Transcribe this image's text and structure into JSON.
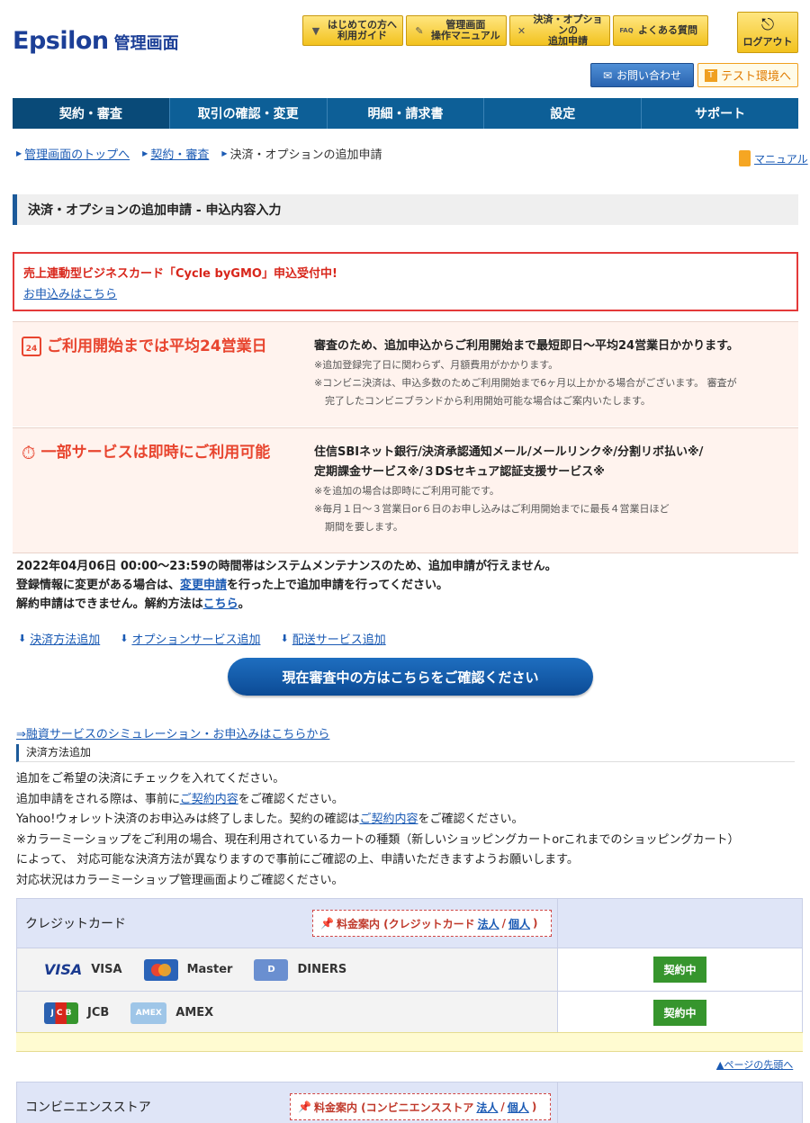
{
  "header": {
    "logo": "Epsilon",
    "logo_sub": "管理画面",
    "help_buttons": [
      {
        "icon": "beginner-icon",
        "label": "はじめての方へ\n利用ガイド"
      },
      {
        "icon": "pencil-icon",
        "label": "管理画面\n操作マニュアル"
      },
      {
        "icon": "tools-icon",
        "label": "決済・オプションの\n追加申請"
      },
      {
        "icon": "faq-icon",
        "label": "よくある質問"
      }
    ],
    "logout": "ログアウト",
    "contact": "お問い合わせ",
    "test_env": "テスト環境へ"
  },
  "nav": [
    {
      "label": "契約・審査",
      "active": true
    },
    {
      "label": "取引の確認・変更"
    },
    {
      "label": "明細・請求書"
    },
    {
      "label": "設定"
    },
    {
      "label": "サポート"
    }
  ],
  "breadcrumb": [
    "管理画面のトップへ",
    "契約・審査",
    "決済・オプションの追加申請"
  ],
  "manual": "マニュアル",
  "page_title": "決済・オプションの追加申請 - 申込内容入力",
  "notice": {
    "title": "売上連動型ビジネスカード「Cycle byGMO」申込受付中!",
    "link": "お申込みはこちら"
  },
  "info1": {
    "icon_text": "24",
    "heading": "ご利用開始までは平均24営業日",
    "title": "審査のため、追加申込からご利用開始まで最短即日～平均24営業日かかります。",
    "note1": "※追加登録完了日に関わらず、月額費用がかかります。",
    "note2": "※コンビニ決済は、申込多数のためご利用開始まで6ヶ月以上かかる場合がございます。 審査が",
    "note3": "完了したコンビニブランドから利用開始可能な場合はご案内いたします。"
  },
  "info2": {
    "heading": "一部サービスは即時にご利用可能",
    "title1": "住信SBIネット銀行/決済承認通知メール/メールリンク※/分割リボ払い※/",
    "title2": "定期課金サービス※/３DSセキュア認証支援サービス※",
    "note1": "※を追加の場合は即時にご利用可能です。",
    "note2": "※毎月１日～３営業日or６日のお申し込みはご利用開始までに最長４営業日ほど",
    "note3": "期間を要します。"
  },
  "maintenance": {
    "line1": "2022年04月06日 00:00～23:59の時間帯はシステムメンテナンスのため、追加申請が行えません。",
    "line2_pre": "登録情報に変更がある場合は、",
    "line2_link": "変更申請",
    "line2_post": "を行った上で追加申請を行ってください。",
    "line3_pre": "解約申請はできません。解約方法は",
    "line3_link": "こちら",
    "line3_post": "。"
  },
  "anchors": [
    "決済方法追加",
    "オプションサービス追加",
    "配送サービス追加"
  ],
  "review_button": "現在審査中の方はこちらをご確認ください",
  "finance_link": "⇒融資サービスのシミュレーション・お申込みはこちらから",
  "section_title": "決済方法追加",
  "description": {
    "l1": "追加をご希望の決済にチェックを入れてください。",
    "l2_pre": "追加申請をされる際は、事前に",
    "l2_link": "ご契約内容",
    "l2_post": "をご確認ください。",
    "l3_pre": "Yahoo!ウォレット決済のお申込みは終了しました。契約の確認は",
    "l3_link": "ご契約内容",
    "l3_post": "をご確認ください。",
    "l4": "※カラーミーショップをご利用の場合、現在利用されているカートの種類（新しいショッピングカートorこれまでのショッピングカート）",
    "l5": "によって、 対応可能な決済方法が異なりますので事前にご確認の上、申請いただきますようお願いします。",
    "l6": "対応状況はカラーミーショップ管理画面よりご確認ください。"
  },
  "credit": {
    "title": "クレジットカード",
    "price_pre": "料金案内 (クレジットカード",
    "price_corp": "法人",
    "price_sep": "/",
    "price_indiv": "個人",
    "price_post": ")",
    "row1": {
      "visa_logo": "VISA",
      "visa": "VISA",
      "master": "Master",
      "diners_logo": "D",
      "diners": "DINERS",
      "status": "契約中"
    },
    "row2": {
      "jcb_logo": "J C B",
      "jcb": "JCB",
      "amex_logo": "AMEX",
      "amex": "AMEX",
      "status": "契約中"
    }
  },
  "pagetop": "▲ページの先頭へ",
  "convenience": {
    "title": "コンビニエンスストア",
    "price_pre": "料金案内 (コンビニエンスストア",
    "price_corp": "法人",
    "price_sep": "/",
    "price_indiv": "個人",
    "price_post": ")"
  }
}
